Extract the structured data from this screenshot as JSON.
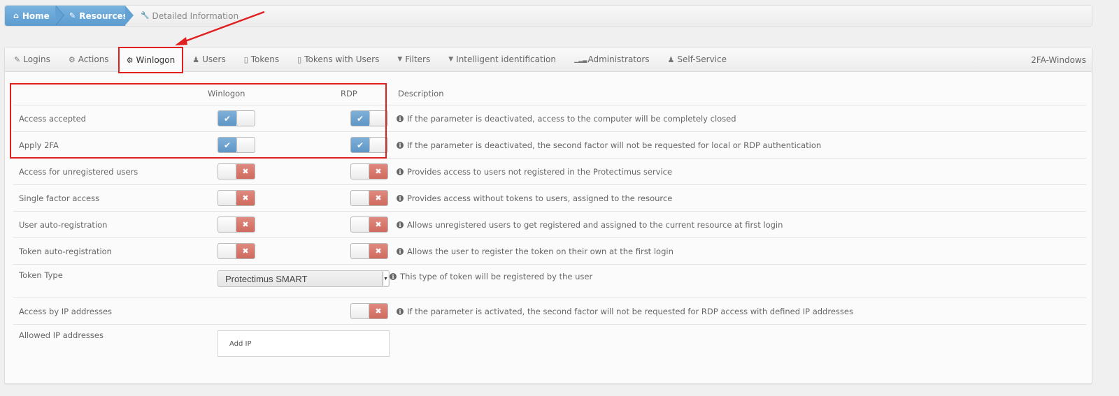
{
  "breadcrumb": {
    "items": [
      {
        "label": "Home",
        "icon": "home-icon"
      },
      {
        "label": "Resources",
        "icon": "edit-icon"
      },
      {
        "label": "Detailed Information",
        "icon": "wrench-icon"
      }
    ]
  },
  "tabs": {
    "items": [
      {
        "label": "Logins",
        "icon": "edit-icon",
        "glyph": "✎"
      },
      {
        "label": "Actions",
        "icon": "gear-icon",
        "glyph": "⚙"
      },
      {
        "label": "Winlogon",
        "icon": "gear-icon",
        "glyph": "⚙",
        "active": true
      },
      {
        "label": "Users",
        "icon": "user-icon",
        "glyph": "👤"
      },
      {
        "label": "Tokens",
        "icon": "mobile-icon",
        "glyph": "▯"
      },
      {
        "label": "Tokens with Users",
        "icon": "mobile-icon",
        "glyph": "▯"
      },
      {
        "label": "Filters",
        "icon": "filter-icon",
        "glyph": "▼"
      },
      {
        "label": "Intelligent identification",
        "icon": "filter-icon",
        "glyph": "▼"
      },
      {
        "label": "Administrators",
        "icon": "signal-icon",
        "glyph": "▁▂▃"
      },
      {
        "label": "Self-Service",
        "icon": "sitemap-icon",
        "glyph": "♟"
      }
    ],
    "right_label": "2FA-Windows"
  },
  "table": {
    "headers": {
      "label": "",
      "winlogon": "Winlogon",
      "rdp": "RDP",
      "description": "Description"
    },
    "rows": [
      {
        "label": "Access accepted",
        "winlogon": true,
        "rdp": true,
        "description": "If the parameter is deactivated, access to the computer will be completely closed"
      },
      {
        "label": "Apply 2FA",
        "winlogon": true,
        "rdp": true,
        "description": "If the parameter is deactivated, the second factor will not be requested for local or RDP authentication"
      },
      {
        "label": "Access for unregistered users",
        "winlogon": false,
        "rdp": false,
        "description": "Provides access to users not registered in the Protectimus service"
      },
      {
        "label": "Single factor access",
        "winlogon": false,
        "rdp": false,
        "description": "Provides access without tokens to users, assigned to the resource"
      },
      {
        "label": "User auto-registration",
        "winlogon": false,
        "rdp": false,
        "description": "Allows unregistered users to get registered and assigned to the current resource at first login"
      },
      {
        "label": "Token auto-registration",
        "winlogon": false,
        "rdp": false,
        "description": "Allows the user to register the token on their own at the first login"
      }
    ],
    "token_type": {
      "label": "Token Type",
      "selected": "Protectimus SMART",
      "description": "This type of token will be registered by the user"
    },
    "ip_access": {
      "label": "Access by IP addresses",
      "rdp": false,
      "description": "If the parameter is activated, the second factor will not be requested for RDP access with defined IP addresses"
    },
    "allowed_ips": {
      "label": "Allowed IP addresses",
      "button_label": "Add IP"
    }
  },
  "glyphs": {
    "check": "✔",
    "cross": "✖",
    "info": "i",
    "select_arrow": "▼",
    "home": "⌂",
    "edit": "✎",
    "wrench": "🔧"
  },
  "colors": {
    "toggle_on": "#5f96c6",
    "toggle_off": "#cf6a5e",
    "annotation": "#e02020",
    "breadcrumb": "#5b9bd0"
  }
}
